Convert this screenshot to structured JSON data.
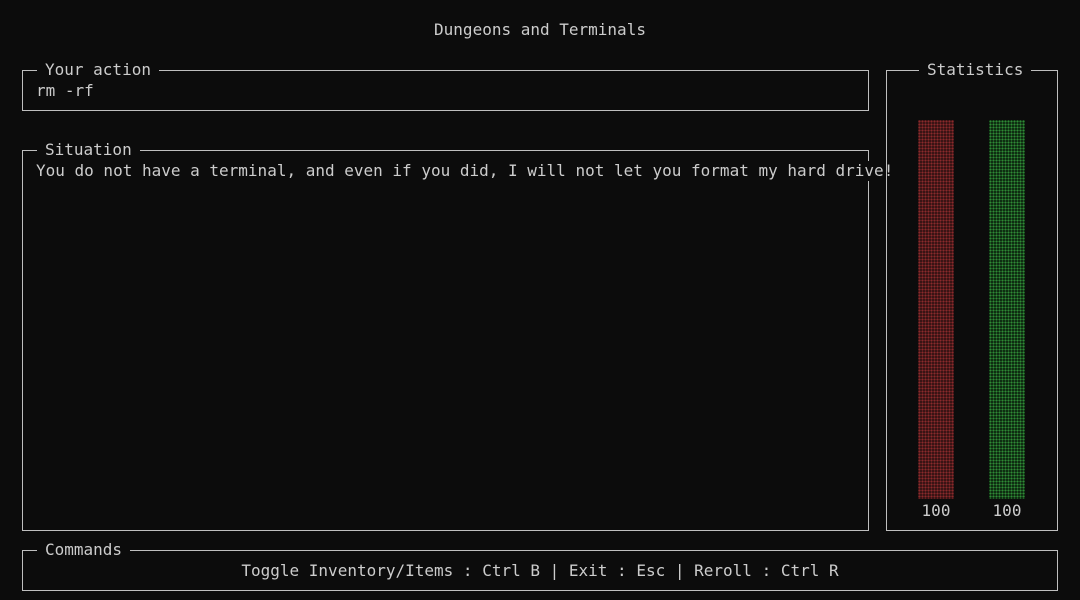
{
  "app": {
    "title": "Dungeons and Terminals"
  },
  "action": {
    "label": "Your action",
    "value": "rm -rf"
  },
  "situation": {
    "label": "Situation",
    "text": "You do not have a terminal, and even if you did, I will not let you format my hard drive!"
  },
  "statistics": {
    "label": "Statistics",
    "bars": [
      {
        "value": 100,
        "display": "100",
        "fill_fraction": 1.0,
        "color": "#8a2a2c"
      },
      {
        "value": 100,
        "display": "100",
        "fill_fraction": 1.0,
        "color": "#2f8a36"
      }
    ]
  },
  "commands": {
    "label": "Commands",
    "items": [
      {
        "action": "Toggle Inventory/Items",
        "key": "Ctrl B"
      },
      {
        "action": "Exit",
        "key": "Esc"
      },
      {
        "action": "Reroll",
        "key": "Ctrl R"
      }
    ],
    "separator": " | ",
    "key_separator": " : "
  },
  "colors": {
    "background": "#0c0c0c",
    "text": "#cccccc",
    "border": "#bfbfbf"
  }
}
